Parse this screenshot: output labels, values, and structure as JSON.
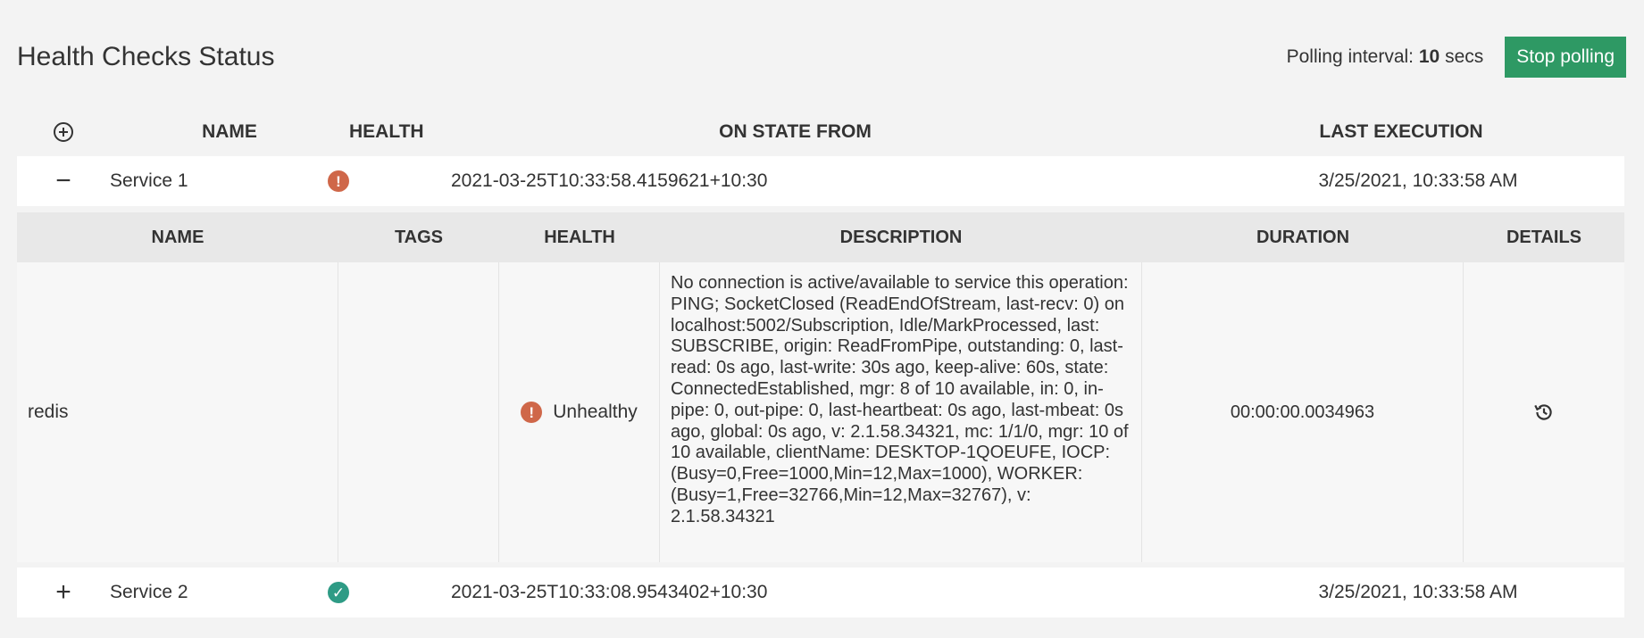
{
  "header": {
    "title": "Health Checks Status",
    "polling_label": "Polling interval:",
    "polling_value": "10",
    "polling_unit": "secs",
    "stop_button": "Stop polling"
  },
  "columns": {
    "name": "NAME",
    "health": "HEALTH",
    "on_state_from": "ON STATE FROM",
    "last_execution": "LAST EXECUTION"
  },
  "services": [
    {
      "toggle": "−",
      "name": "Service 1",
      "status": "unhealthy",
      "on_state_from": "2021-03-25T10:33:58.4159621+10:30",
      "last_execution": "3/25/2021, 10:33:58 AM"
    },
    {
      "toggle": "+",
      "name": "Service 2",
      "status": "healthy",
      "on_state_from": "2021-03-25T10:33:08.9543402+10:30",
      "last_execution": "3/25/2021, 10:33:58 AM"
    }
  ],
  "entries_columns": {
    "name": "NAME",
    "tags": "TAGS",
    "health": "HEALTH",
    "description": "DESCRIPTION",
    "duration": "DURATION",
    "details": "DETAILS"
  },
  "entries": [
    {
      "name": "redis",
      "tags": "",
      "health": "Unhealthy",
      "description": "No connection is active/available to service this operation: PING; SocketClosed (ReadEndOfStream, last-recv: 0) on localhost:5002/Subscription, Idle/MarkProcessed, last: SUBSCRIBE, origin: ReadFromPipe, outstanding: 0, last-read: 0s ago, last-write: 30s ago, keep-alive: 60s, state: ConnectedEstablished, mgr: 8 of 10 available, in: 0, in-pipe: 0, out-pipe: 0, last-heartbeat: 0s ago, last-mbeat: 0s ago, global: 0s ago, v: 2.1.58.34321, mc: 1/1/0, mgr: 10 of 10 available, clientName: DESKTOP-1QOEUFE, IOCP: (Busy=0,Free=1000,Min=12,Max=1000), WORKER: (Busy=1,Free=32766,Min=12,Max=32767), v: 2.1.58.34321",
      "duration": "00:00:00.0034963"
    }
  ],
  "icons": {
    "expand_all": "plus-circle-icon",
    "unhealthy": "exclamation-circle-icon",
    "healthy": "check-circle-icon",
    "details": "history-icon"
  },
  "colors": {
    "primary_button": "#2e9964",
    "unhealthy": "#cf6749",
    "healthy": "#2e9b85"
  }
}
